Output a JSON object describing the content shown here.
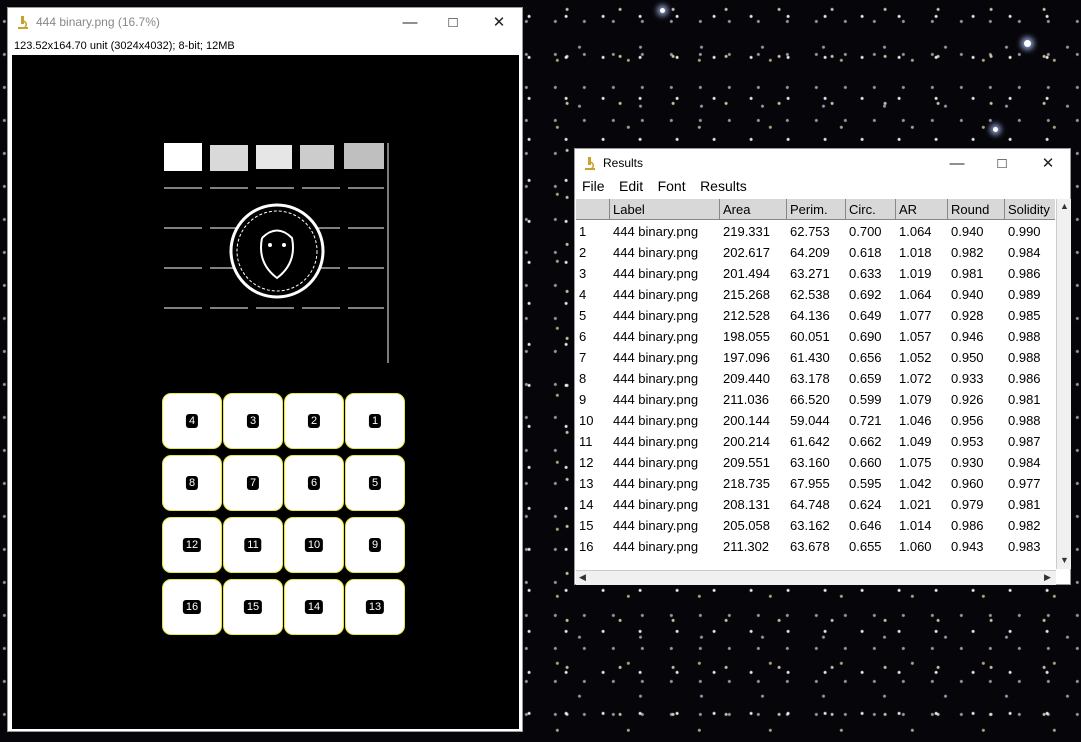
{
  "image_window": {
    "title": "444 binary.png (16.7%)",
    "info": "123.52x164.70 unit (3024x4032); 8-bit; 12MB",
    "tiles": [
      "4",
      "3",
      "2",
      "1",
      "8",
      "7",
      "6",
      "5",
      "12",
      "11",
      "10",
      "9",
      "16",
      "15",
      "14",
      "13"
    ]
  },
  "results_window": {
    "title": "Results",
    "menu": [
      "File",
      "Edit",
      "Font",
      "Results"
    ],
    "columns": [
      "",
      "Label",
      "Area",
      "Perim.",
      "Circ.",
      "AR",
      "Round",
      "Solidity"
    ],
    "rows": [
      [
        "1",
        "444 binary.png",
        "219.331",
        "62.753",
        "0.700",
        "1.064",
        "0.940",
        "0.990"
      ],
      [
        "2",
        "444 binary.png",
        "202.617",
        "64.209",
        "0.618",
        "1.018",
        "0.982",
        "0.984"
      ],
      [
        "3",
        "444 binary.png",
        "201.494",
        "63.271",
        "0.633",
        "1.019",
        "0.981",
        "0.986"
      ],
      [
        "4",
        "444 binary.png",
        "215.268",
        "62.538",
        "0.692",
        "1.064",
        "0.940",
        "0.989"
      ],
      [
        "5",
        "444 binary.png",
        "212.528",
        "64.136",
        "0.649",
        "1.077",
        "0.928",
        "0.985"
      ],
      [
        "6",
        "444 binary.png",
        "198.055",
        "60.051",
        "0.690",
        "1.057",
        "0.946",
        "0.988"
      ],
      [
        "7",
        "444 binary.png",
        "197.096",
        "61.430",
        "0.656",
        "1.052",
        "0.950",
        "0.988"
      ],
      [
        "8",
        "444 binary.png",
        "209.440",
        "63.178",
        "0.659",
        "1.072",
        "0.933",
        "0.986"
      ],
      [
        "9",
        "444 binary.png",
        "211.036",
        "66.520",
        "0.599",
        "1.079",
        "0.926",
        "0.981"
      ],
      [
        "10",
        "444 binary.png",
        "200.144",
        "59.044",
        "0.721",
        "1.046",
        "0.956",
        "0.988"
      ],
      [
        "11",
        "444 binary.png",
        "200.214",
        "61.642",
        "0.662",
        "1.049",
        "0.953",
        "0.987"
      ],
      [
        "12",
        "444 binary.png",
        "209.551",
        "63.160",
        "0.660",
        "1.075",
        "0.930",
        "0.984"
      ],
      [
        "13",
        "444 binary.png",
        "218.735",
        "67.955",
        "0.595",
        "1.042",
        "0.960",
        "0.977"
      ],
      [
        "14",
        "444 binary.png",
        "208.131",
        "64.748",
        "0.624",
        "1.021",
        "0.979",
        "0.981"
      ],
      [
        "15",
        "444 binary.png",
        "205.058",
        "63.162",
        "0.646",
        "1.014",
        "0.986",
        "0.982"
      ],
      [
        "16",
        "444 binary.png",
        "211.302",
        "63.678",
        "0.655",
        "1.060",
        "0.943",
        "0.983"
      ]
    ]
  }
}
